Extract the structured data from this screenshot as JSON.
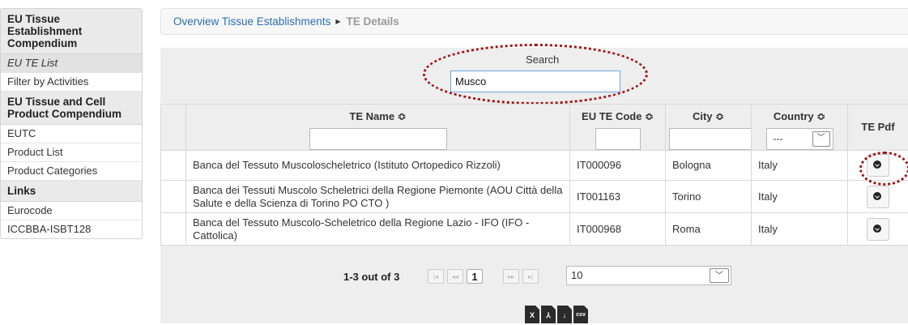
{
  "sidebar": {
    "sections": [
      {
        "heading": "EU Tissue Establishment Compendium",
        "items": [
          {
            "label": "EU TE List",
            "italic": true
          },
          {
            "label": "Filter by Activities",
            "italic": false
          }
        ]
      },
      {
        "heading": "EU Tissue and Cell Product Compendium",
        "items": [
          {
            "label": "EUTC",
            "italic": false
          },
          {
            "label": "Product List",
            "italic": false
          },
          {
            "label": "Product Categories",
            "italic": false
          }
        ]
      },
      {
        "heading": "Links",
        "items": [
          {
            "label": "Eurocode",
            "italic": false
          },
          {
            "label": "ICCBBA-ISBT128",
            "italic": false
          }
        ]
      }
    ]
  },
  "breadcrumb": {
    "link": "Overview Tissue Establishments",
    "current": "TE Details"
  },
  "search": {
    "label": "Search",
    "value": "Musco"
  },
  "table": {
    "columns": {
      "name": "TE Name ≎",
      "code": "EU TE Code ≎",
      "city": "City ≎",
      "country": "Country ≎",
      "pdf": "TE Pdf"
    },
    "country_filter_value": "---",
    "rows": [
      {
        "name": "Banca del Tessuto Muscoloscheletrico (Istituto Ortopedico Rizzoli)",
        "code": "IT000096",
        "city": "Bologna",
        "country": "Italy"
      },
      {
        "name": "Banca dei Tessuti Muscolo Scheletrici della Regione Piemonte (AOU Città della Salute e della Scienza di Torino PO CTO )",
        "code": "IT001163",
        "city": "Torino",
        "country": "Italy"
      },
      {
        "name": "Banca del Tessuto Muscolo-Scheletrico della Regione Lazio - IFO (IFO - Cattolica)",
        "code": "IT000968",
        "city": "Roma",
        "country": "Italy"
      }
    ]
  },
  "pager": {
    "info": "1-3 out of 3",
    "current_page": "1",
    "page_size": "10"
  },
  "exports": [
    {
      "icon": "excel-export-icon",
      "label": "X"
    },
    {
      "icon": "pdf-export-icon",
      "label": "⅄"
    },
    {
      "icon": "download-icon",
      "label": "↓"
    },
    {
      "icon": "csv-export-icon",
      "label": "csv"
    }
  ],
  "colors": {
    "link": "#2a6fb0",
    "annotation": "#a01515",
    "panel": "#eeeeee"
  }
}
